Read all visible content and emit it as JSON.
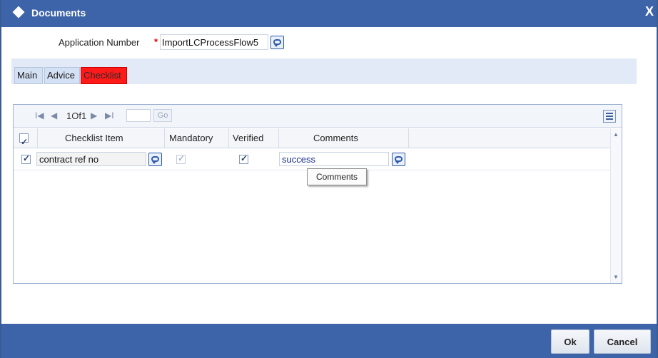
{
  "window": {
    "title": "Documents",
    "close_label": "X"
  },
  "form": {
    "app_number_label": "Application Number",
    "required_marker": "*",
    "app_number_value": "ImportLCProcessFlow5"
  },
  "tabs": [
    {
      "label": "Main",
      "active": false
    },
    {
      "label": "Advice",
      "active": false
    },
    {
      "label": "Checklist",
      "active": true
    }
  ],
  "grid": {
    "pagination": {
      "first": "I◀",
      "prev": "◀",
      "page_text": "1Of1",
      "next": "▶",
      "last": "▶I",
      "go_label": "Go"
    },
    "columns": [
      "Checklist Item",
      "Mandatory",
      "Verified",
      "Comments"
    ],
    "rows": [
      {
        "selected": true,
        "checklist_item": "contract ref no",
        "mandatory": true,
        "verified": true,
        "comments": "success"
      }
    ]
  },
  "tooltip": {
    "text": "Comments"
  },
  "buttons": {
    "ok": "Ok",
    "cancel": "Cancel"
  },
  "colors": {
    "titlebar": "#3d64a8",
    "active_tab": "#ff1a1a",
    "footer": "#3d64a8"
  }
}
